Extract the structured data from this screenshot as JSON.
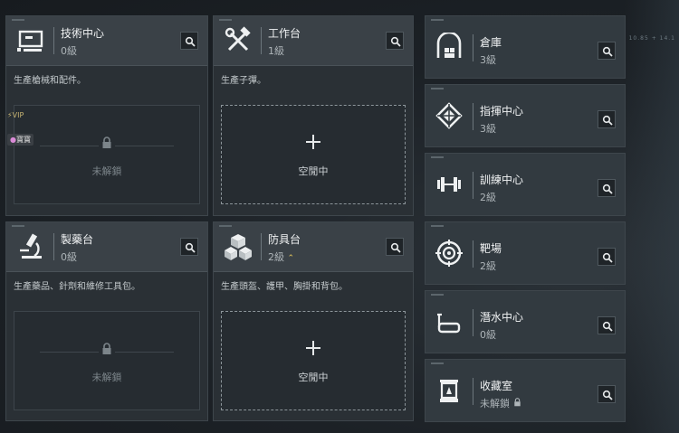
{
  "cards_left": [
    {
      "title": "技術中心",
      "level": "0級",
      "desc": "生產槍械和配件。",
      "slot": "未解鎖",
      "icon": "computer-terminal-icon"
    },
    {
      "title": "工作台",
      "level": "1級",
      "desc": "生產子彈。",
      "slot": "空閒中",
      "icon": "hammer-wrench-icon"
    },
    {
      "title": "製藥台",
      "level": "0級",
      "desc": "生產藥品、針劑和維修工具包。",
      "slot": "未解鎖",
      "icon": "microscope-icon"
    },
    {
      "title": "防具台",
      "level": "2級",
      "desc": "生產頭盔、護甲、胸掛和背包。",
      "slot": "空閒中",
      "icon": "armor-cubes-icon"
    }
  ],
  "cards_right": [
    {
      "title": "倉庫",
      "level": "3級",
      "icon": "warehouse-icon"
    },
    {
      "title": "指揮中心",
      "level": "3級",
      "icon": "command-emblem-icon"
    },
    {
      "title": "訓練中心",
      "level": "2級",
      "icon": "dumbbell-icon"
    },
    {
      "title": "靶場",
      "level": "2級",
      "icon": "target-icon"
    },
    {
      "title": "潛水中心",
      "level": "0級",
      "icon": "diving-mask-icon"
    },
    {
      "title": "收藏室",
      "level": "未解鎖",
      "icon": "display-case-icon"
    }
  ],
  "badges": {
    "vip": "VIP",
    "treasure": "寶寶"
  },
  "deco_text": "10.85 + 14.1"
}
